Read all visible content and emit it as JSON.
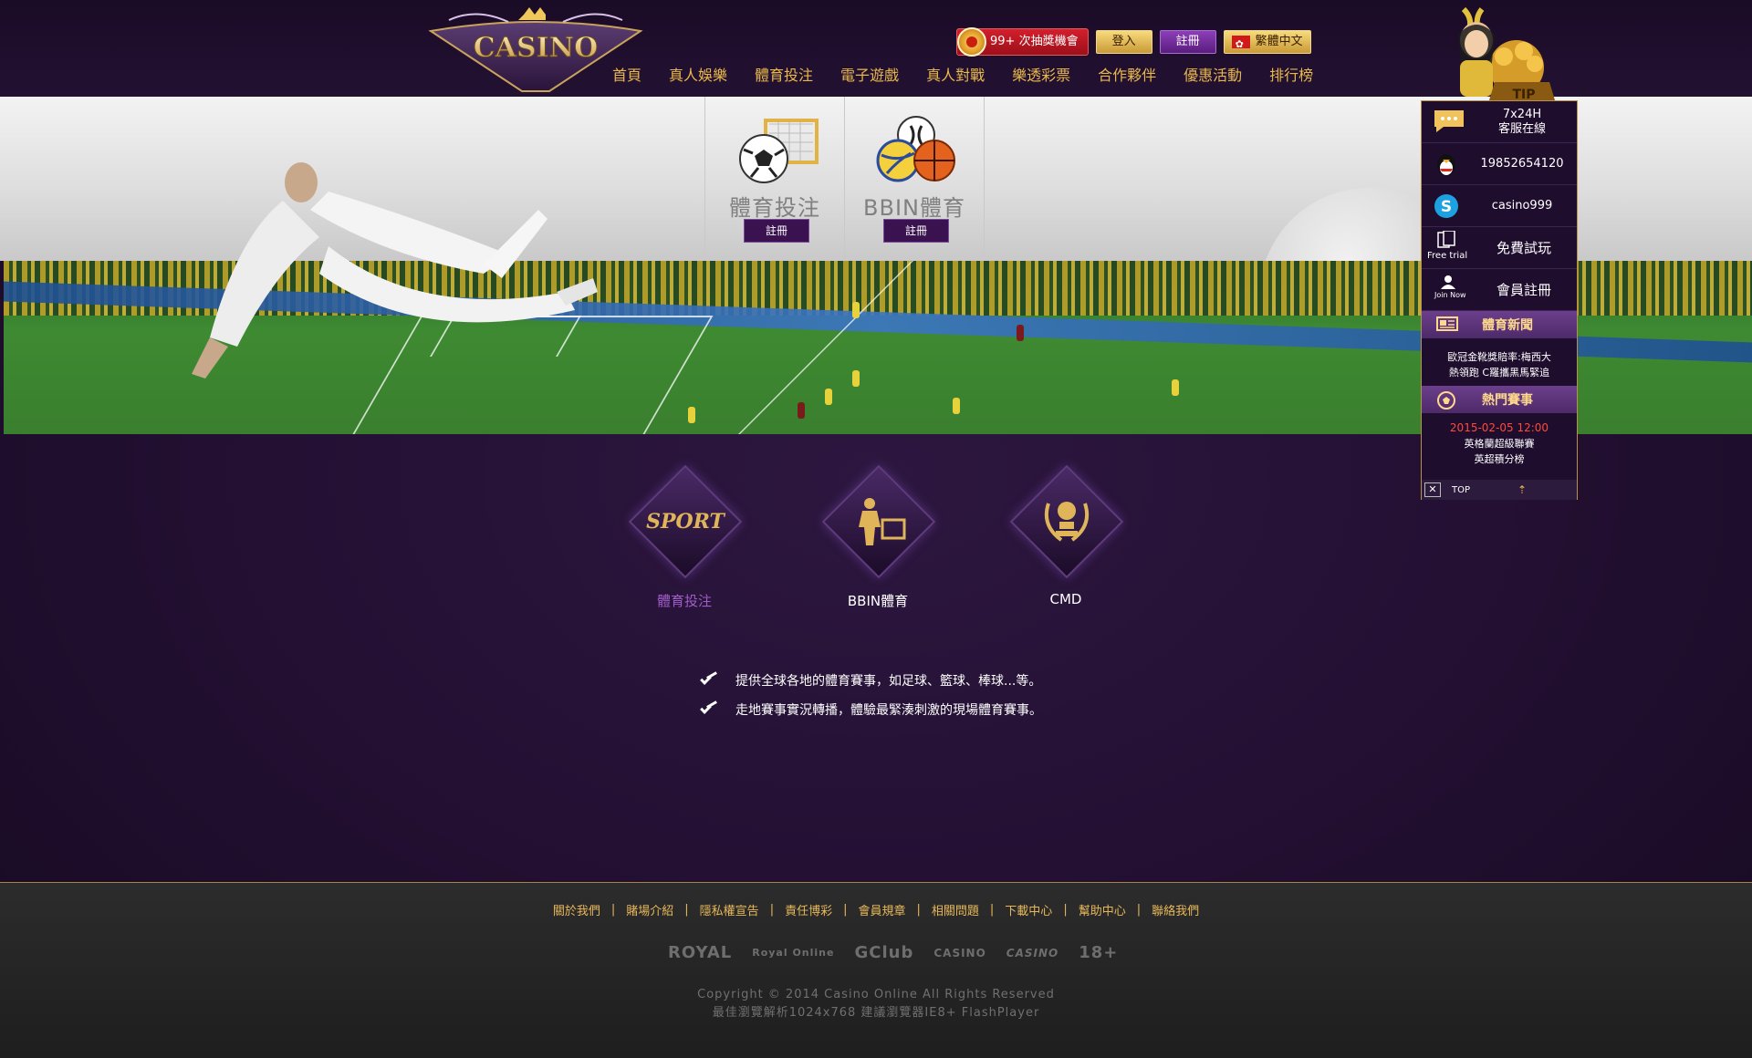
{
  "header": {
    "lottery_count_label": "99+ 次抽獎機會",
    "login_label": "登入",
    "register_label": "註冊",
    "language_label": "繁體中文",
    "logo_text": "CASINO",
    "nav": [
      "首頁",
      "真人娛樂",
      "體育投注",
      "電子遊戲",
      "真人對戰",
      "樂透彩票",
      "合作夥伴",
      "優惠活動",
      "排行榜"
    ]
  },
  "banner": {
    "tiles": [
      {
        "title": "體育投注",
        "button": "註冊"
      },
      {
        "title": "BBIN體育",
        "button": "註冊"
      }
    ]
  },
  "categories": [
    {
      "label": "體育投注",
      "icon_text": "SPORT",
      "active": true
    },
    {
      "label": "BBIN體育",
      "icon_text": "",
      "active": false
    },
    {
      "label": "CMD",
      "icon_text": "",
      "active": false
    }
  ],
  "features": [
    "提供全球各地的體育賽事，如足球、籃球、棒球...等。",
    "走地賽事實況轉播，體驗最緊湊刺激的現場體育賽事。"
  ],
  "side_panel": {
    "mascot_tag": "TIP",
    "support_line1": "7x24H",
    "support_line2": "客服在線",
    "qq_number": "19852654120",
    "skype": "casino999",
    "free_trial_icon_text": "Free trial",
    "free_trial_label": "免費試玩",
    "join_icon_text": "Join Now",
    "join_label": "會員註冊",
    "news_title": "體育新聞",
    "news_line1": "歐冠金靴獎賠率:梅西大",
    "news_line2": "熱領跑 C羅攜黑馬緊追",
    "match_title": "熱門賽事",
    "match_date": "2015-02-05 12:00",
    "match_league": "英格蘭超級聯賽",
    "match_desc": "英超積分榜",
    "top_label": "TOP"
  },
  "footer": {
    "links": [
      "關於我們",
      "賭場介紹",
      "隱私權宣告",
      "責任博彩",
      "會員規章",
      "相關問題",
      "下載中心",
      "幫助中心",
      "聯絡我們"
    ],
    "partners": [
      "ROYAL",
      "Royal Online",
      "GClub",
      "CASINO",
      "CASINO",
      "18+"
    ],
    "copyright": "Copyright © 2014 Casino Online All Rights Reserved",
    "browser_note": "最佳瀏覽解析1024x768 建議瀏覽器IE8+ FlashPlayer"
  },
  "colors": {
    "gold": "#e8b84c",
    "purple_bg": "#220f31",
    "accent_purple": "#a05cc8",
    "red_date": "#ff4a3a"
  }
}
